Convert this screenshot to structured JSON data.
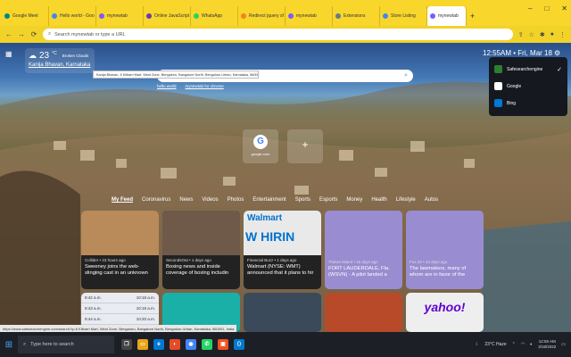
{
  "browser": {
    "tabs": [
      {
        "label": "Google Meet",
        "color": "#00897b"
      },
      {
        "label": "Hello world - Goo",
        "color": "#4285f4"
      },
      {
        "label": "mynewtab",
        "color": "#7b5cff"
      },
      {
        "label": "Online JavaScript",
        "color": "#673ab7"
      },
      {
        "label": "WhatsApp",
        "color": "#25d366"
      },
      {
        "label": "Redirect jquery sf",
        "color": "#f48024"
      },
      {
        "label": "mynewtab",
        "color": "#7b5cff"
      },
      {
        "label": "Extensions",
        "color": "#607d8b"
      },
      {
        "label": "Store Listing",
        "color": "#4285f4"
      },
      {
        "label": "mynewtab",
        "color": "#7b5cff"
      }
    ],
    "address_placeholder": "Search mynewtab or type a URL"
  },
  "weather": {
    "temp": "23",
    "unit": "°C",
    "desc": "Broken Clouds",
    "location": "Kanija Bhavan, Karnataka"
  },
  "clock": "12:55AM • Fri, Mar 18",
  "search": {
    "autocomplete": "Kanija Bhavan, 6 Kilbarri Mart, West Zone, Bengaluru, Bangalore North, Bengaluru Urban, Karnataka, 560001, India",
    "links": [
      "hello world",
      "mynewtab for chrome"
    ]
  },
  "shortcuts": [
    {
      "label": "google.com"
    }
  ],
  "engines": [
    {
      "name": "Safesearchengine",
      "selected": true,
      "color": "#2e7d32"
    },
    {
      "name": "Google",
      "selected": false,
      "color": "#ffffff"
    },
    {
      "name": "Bing",
      "selected": false,
      "color": "#0078d4"
    }
  ],
  "feed_tabs": [
    "My Feed",
    "Coronavirus",
    "News",
    "Videos",
    "Photos",
    "Entertainment",
    "Sports",
    "Esports",
    "Money",
    "Health",
    "Lifestyle",
    "Autos"
  ],
  "cards": [
    {
      "meta": "Collider • 23 hours ago",
      "title": "Sweeney joins the web-slinging cast in an unknown",
      "color": "#b98a5a"
    },
    {
      "meta": "SecondsOut • 1 days ago",
      "title": "Boxing news and inside coverage of boxing includin",
      "color": "#6f5a4a"
    },
    {
      "meta": "Financial Buzz • 1 days ago",
      "title": "Walmart (NYSE: WMT) announced that it plans to hir",
      "color": "#e9e9e9",
      "brand": "Walmart",
      "sign": "W HIRIN"
    },
    {
      "meta": "7News Miami • 16 days ago",
      "title": "FORT LAUDERDALE, Fla. (WSVN) - A pilot landed a",
      "color": "#9a8cd0"
    },
    {
      "meta": "Fox 23 • 23 days ago",
      "title": "The lawmakers, many of whom are in favor of the",
      "color": "#9a8cd0"
    }
  ],
  "bottom_cards": [
    {
      "color": "#e8ecf2",
      "rows": [
        "9:42 a.m.",
        "9:43 a.m.",
        "9:44 a.m."
      ],
      "times": [
        "10:18 a.m.",
        "10:19 a.m.",
        "10:20 a.m."
      ]
    },
    {
      "color": "#1ab0a8"
    },
    {
      "color": "#3a4a5a"
    },
    {
      "color": "#b84a2a"
    },
    {
      "color": "#eeeeee",
      "logo": "yahoo!"
    }
  ],
  "status_url": "https://www.safesearchengine.com/search?q=6 Kilbarri Mart, West Zone, Bengaluru, Bangalore North, Bengaluru Urban, Karnataka, 560001, India",
  "taskbar": {
    "search_placeholder": "Type here to search",
    "weather": "23°C Haze",
    "time": "12:55 AM",
    "date": "3/18/2022"
  }
}
